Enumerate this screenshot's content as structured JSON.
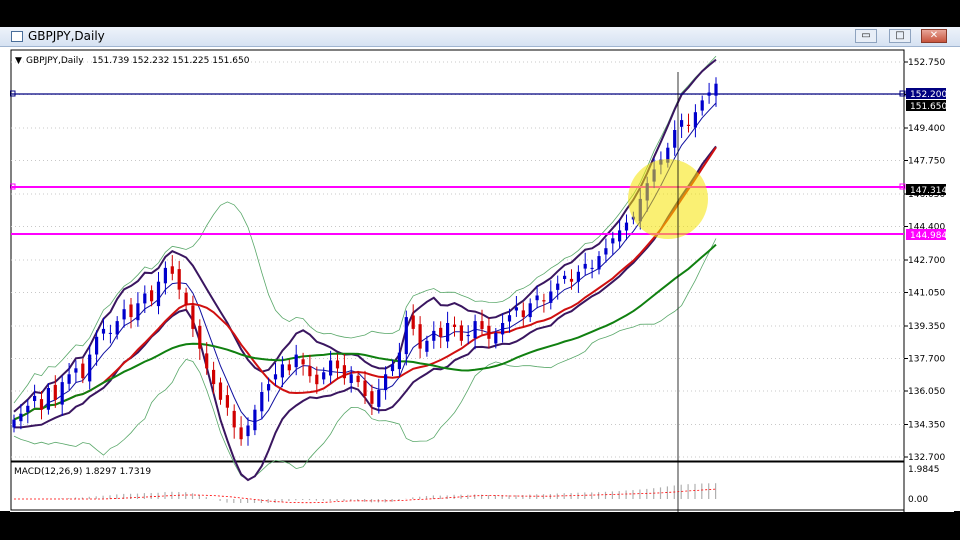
{
  "window": {
    "title": "GBPJPY,Daily",
    "min_glyph": "▭",
    "max_glyph": "□",
    "close_glyph": "✕"
  },
  "chart": {
    "symbol_label": "GBPJPY,Daily",
    "ohlc_text": "151.739 152.232 151.225 151.650",
    "arrow_glyph": "▼",
    "macd_label": "MACD(12,26,9) 1.8297 1.7319",
    "price_scale": [
      "152.750",
      "151.100",
      "149.400",
      "147.750",
      "146.050",
      "144.400",
      "142.700",
      "141.050",
      "139.350",
      "137.700",
      "136.050",
      "134.350",
      "132.700"
    ],
    "macd_scale": [
      "1.9845",
      "0.00"
    ],
    "tags": {
      "blue_line": "152.200",
      "current_price": "151.650",
      "pink_line_1": "147.314",
      "pink_line_2": "144.984"
    }
  },
  "chart_data": {
    "type": "candlestick",
    "symbol": "GBPJPY",
    "timeframe": "Daily",
    "last_bar": {
      "open": 151.739,
      "high": 152.232,
      "low": 151.225,
      "close": 151.65
    },
    "horizontal_lines": [
      {
        "price": 152.2,
        "color": "#000080"
      },
      {
        "price": 147.314,
        "color": "#ff00ff"
      },
      {
        "price": 144.984,
        "color": "#ff00ff"
      }
    ],
    "ylim": [
      132.7,
      152.75
    ],
    "closes": [
      134.6,
      134.9,
      135.3,
      135.8,
      135.1,
      136.2,
      135.6,
      136.5,
      136.9,
      137.2,
      136.7,
      137.9,
      138.8,
      139.2,
      139.0,
      139.6,
      140.2,
      139.8,
      140.5,
      141.0,
      140.6,
      141.6,
      142.3,
      142.0,
      141.2,
      140.4,
      139.2,
      138.2,
      137.2,
      136.4,
      135.6,
      135.2,
      134.2,
      133.6,
      134.3,
      135.1,
      136.0,
      136.4,
      136.9,
      137.4,
      137.1,
      137.9,
      137.4,
      136.8,
      136.4,
      137.0,
      137.6,
      137.2,
      136.7,
      136.9,
      136.5,
      135.8,
      135.4,
      136.1,
      136.9,
      137.4,
      138.0,
      139.8,
      139.2,
      138.2,
      138.6,
      139.1,
      138.8,
      139.5,
      139.3,
      138.6,
      138.9,
      139.6,
      139.2,
      138.7,
      139.0,
      139.5,
      139.9,
      140.3,
      139.8,
      140.5,
      140.9,
      140.6,
      141.1,
      141.5,
      141.9,
      141.6,
      142.1,
      142.5,
      142.3,
      142.9,
      143.3,
      143.8,
      144.2,
      144.6,
      144.9,
      145.8,
      146.6,
      147.3,
      147.8,
      148.4,
      149.3,
      149.8,
      149.5,
      150.2,
      150.8,
      151.2,
      151.65
    ],
    "indicators": [
      "Moving averages (blue, red, green)",
      "Bollinger bands (dark purple, light green)"
    ],
    "macd": {
      "label": "MACD(12,26,9)",
      "main": 1.8297,
      "signal": 1.7319,
      "ylim": [
        0.0,
        1.9845
      ]
    }
  }
}
